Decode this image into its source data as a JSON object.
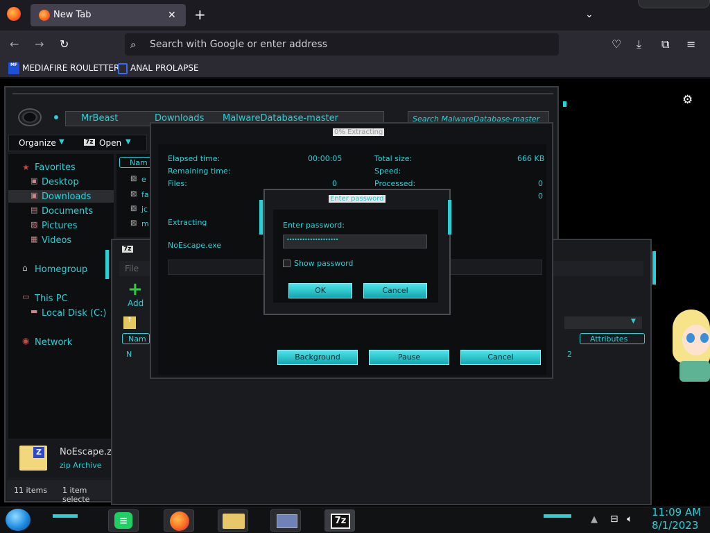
{
  "browser": {
    "tab_title": "New Tab",
    "url_placeholder": "Search with Google or enter address",
    "bookmarks": [
      {
        "label": "MEDIAFIRE ROULETTER",
        "icon_text": "MF"
      },
      {
        "label": "ANAL PROLAPSE"
      }
    ]
  },
  "explorer": {
    "breadcrumb": [
      "MrBeast",
      "Downloads",
      "MalwareDatabase-master"
    ],
    "search_placeholder": "Search MalwareDatabase-master",
    "toolbar": {
      "organize": "Organize",
      "open": "Open",
      "open_icon": "7z"
    },
    "column_name": "Nam",
    "nav": {
      "favorites": "Favorites",
      "desktop": "Desktop",
      "downloads": "Downloads",
      "documents": "Documents",
      "pictures": "Pictures",
      "videos": "Videos",
      "homegroup": "Homegroup",
      "this_pc": "This PC",
      "local_disk": "Local Disk (C:)",
      "network": "Network"
    },
    "file_rows": [
      "e",
      "fa",
      "jc",
      "m"
    ],
    "details": {
      "name": "NoEscape.z",
      "type": "zip Archive",
      "icon_text": "Z"
    },
    "status": {
      "items": "11 items",
      "selected": "1 item selecte"
    }
  },
  "sevenzip_window": {
    "menu_file": "File",
    "add_label": "Add",
    "column_name": "Nam",
    "column_attributes": "Attributes",
    "row_name": "N",
    "row_size": "2"
  },
  "extract_dialog": {
    "title": "0% Extracting",
    "elapsed_label": "Elapsed time:",
    "elapsed_value": "00:00:05",
    "remaining_label": "Remaining time:",
    "files_label": "Files:",
    "files_value": "0",
    "total_size_label": "Total size:",
    "total_size_value": "666 KB",
    "speed_label": "Speed:",
    "processed_label": "Processed:",
    "processed_value": "0",
    "extra_value": "0",
    "action_label": "Extracting",
    "file_name": "NoEscape.exe",
    "progress": 0,
    "buttons": {
      "background": "Background",
      "pause": "Pause",
      "cancel": "Cancel"
    }
  },
  "password_dialog": {
    "title": "Enter password",
    "label": "Enter password:",
    "value": "••••••••••••••••••••",
    "show_password": "Show password",
    "ok": "OK",
    "cancel": "Cancel"
  },
  "taskbar": {
    "apps": [
      "notes",
      "firefox",
      "file-explorer",
      "control-panel",
      "7zip"
    ],
    "sevenzip_icon_text": "7z",
    "time": "11:09 AM",
    "date": "8/1/2023"
  },
  "colors": {
    "accent": "#29d0d6",
    "chrome_bg": "#1c1b22",
    "toolbar_bg": "#2b2a33",
    "panel_bg": "#1a1b1f"
  }
}
